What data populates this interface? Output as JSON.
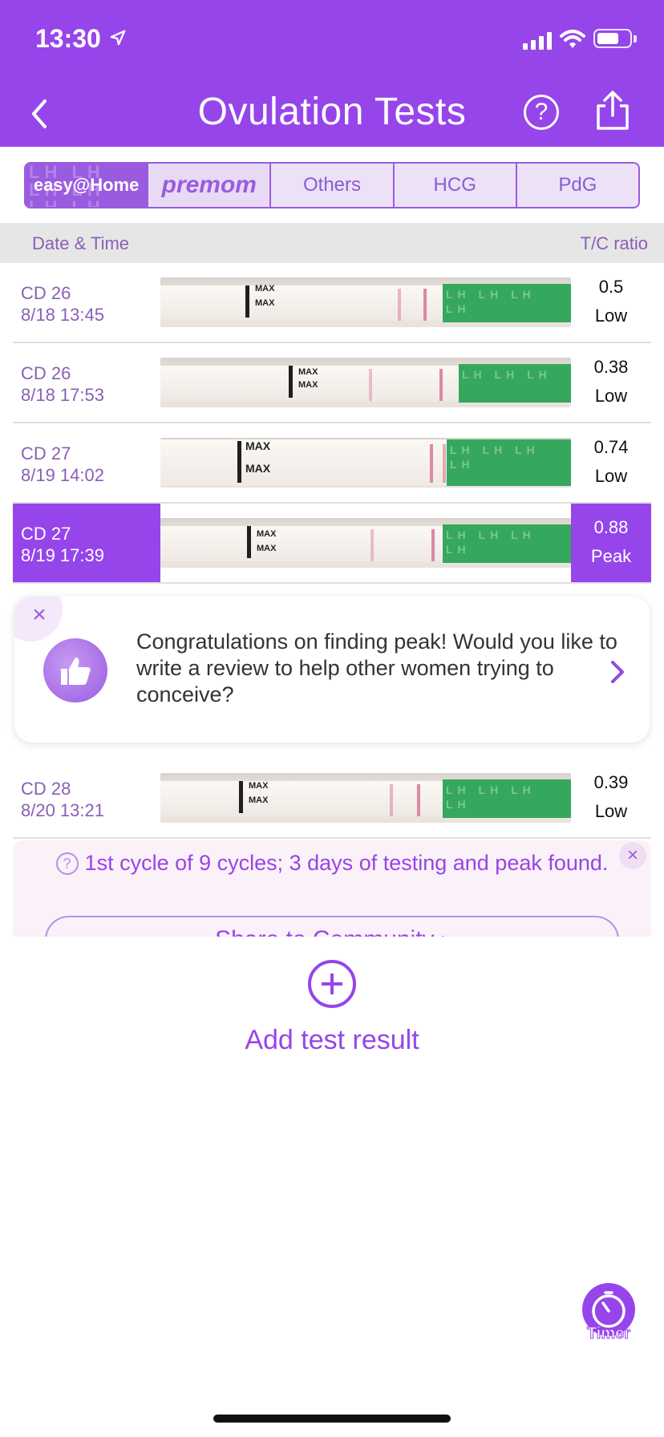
{
  "status_bar": {
    "time": "13:30"
  },
  "header": {
    "title": "Ovulation Tests",
    "help_glyph": "?"
  },
  "brand_tabs": [
    {
      "label": "easy@Home",
      "active": true
    },
    {
      "label": "premom",
      "active": false
    },
    {
      "label": "Others",
      "active": false
    },
    {
      "label": "HCG",
      "active": false
    },
    {
      "label": "PdG",
      "active": false
    }
  ],
  "columns": {
    "date": "Date & Time",
    "ratio": "T/C ratio"
  },
  "rows": [
    {
      "cd": "CD 26",
      "datetime": "8/18 13:45",
      "ratio": "0.5",
      "level": "Low"
    },
    {
      "cd": "CD 26",
      "datetime": "8/18 17:53",
      "ratio": "0.38",
      "level": "Low"
    },
    {
      "cd": "CD 27",
      "datetime": "8/19 14:02",
      "ratio": "0.74",
      "level": "Low"
    },
    {
      "cd": "CD 27",
      "datetime": "8/19 17:39",
      "ratio": "0.88",
      "level": "Peak",
      "selected": true
    },
    {
      "cd": "CD 28",
      "datetime": "8/20 13:21",
      "ratio": "0.39",
      "level": "Low"
    }
  ],
  "strip_label": "MAX",
  "review_popup": {
    "text": "Congratulations on finding peak! Would you like to write a review to help other women trying to conceive?"
  },
  "summary": {
    "text": "1st cycle of 9 cycles; 3 days of testing and peak found.",
    "button": "Share to Community ›"
  },
  "add_result": {
    "label": "Add test result"
  },
  "timer": {
    "label": "Timer"
  },
  "colors": {
    "accent": "#9645ea",
    "strip_green": "#35a85d",
    "row_text": "#8a5fb8"
  }
}
